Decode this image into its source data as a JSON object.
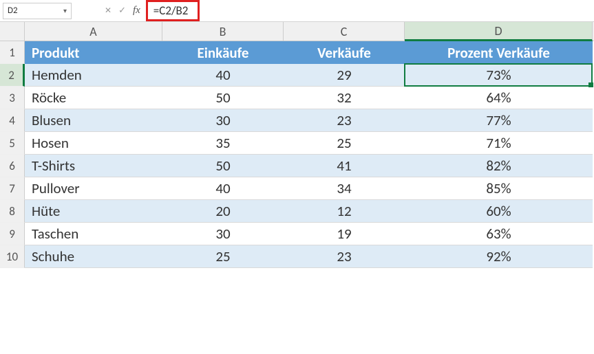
{
  "name_box": "D2",
  "formula": "=C2/B2",
  "columns": [
    "A",
    "B",
    "C",
    "D"
  ],
  "selected_col_index": 3,
  "selected_row_index": 1,
  "headers": {
    "produkt": "Produkt",
    "einkaufe": "Einkäufe",
    "verkaufe": "Verkäufe",
    "prozent": "Prozent Verkäufe"
  },
  "rows": [
    {
      "n": "1",
      "produkt": "",
      "einkaufe": "",
      "verkaufe": "",
      "prozent": ""
    },
    {
      "n": "2",
      "produkt": "Hemden",
      "einkaufe": "40",
      "verkaufe": "29",
      "prozent": "73%"
    },
    {
      "n": "3",
      "produkt": "Röcke",
      "einkaufe": "50",
      "verkaufe": "32",
      "prozent": "64%"
    },
    {
      "n": "4",
      "produkt": "Blusen",
      "einkaufe": "30",
      "verkaufe": "23",
      "prozent": "77%"
    },
    {
      "n": "5",
      "produkt": "Hosen",
      "einkaufe": "35",
      "verkaufe": "25",
      "prozent": "71%"
    },
    {
      "n": "6",
      "produkt": "T-Shirts",
      "einkaufe": "50",
      "verkaufe": "41",
      "prozent": "82%"
    },
    {
      "n": "7",
      "produkt": "Pullover",
      "einkaufe": "40",
      "verkaufe": "34",
      "prozent": "85%"
    },
    {
      "n": "8",
      "produkt": "Hüte",
      "einkaufe": "20",
      "verkaufe": "12",
      "prozent": "60%"
    },
    {
      "n": "9",
      "produkt": "Taschen",
      "einkaufe": "30",
      "verkaufe": "19",
      "prozent": "63%"
    },
    {
      "n": "10",
      "produkt": "Schuhe",
      "einkaufe": "25",
      "verkaufe": "23",
      "prozent": "92%"
    }
  ],
  "chart_data": {
    "type": "table",
    "title": "Prozent Verkäufe",
    "columns": [
      "Produkt",
      "Einkäufe",
      "Verkäufe",
      "Prozent Verkäufe"
    ],
    "rows": [
      [
        "Hemden",
        40,
        29,
        "73%"
      ],
      [
        "Röcke",
        50,
        32,
        "64%"
      ],
      [
        "Blusen",
        30,
        23,
        "77%"
      ],
      [
        "Hosen",
        35,
        25,
        "71%"
      ],
      [
        "T-Shirts",
        50,
        41,
        "82%"
      ],
      [
        "Pullover",
        40,
        34,
        "85%"
      ],
      [
        "Hüte",
        20,
        12,
        "60%"
      ],
      [
        "Taschen",
        30,
        19,
        "63%"
      ],
      [
        "Schuhe",
        25,
        23,
        "92%"
      ]
    ]
  }
}
